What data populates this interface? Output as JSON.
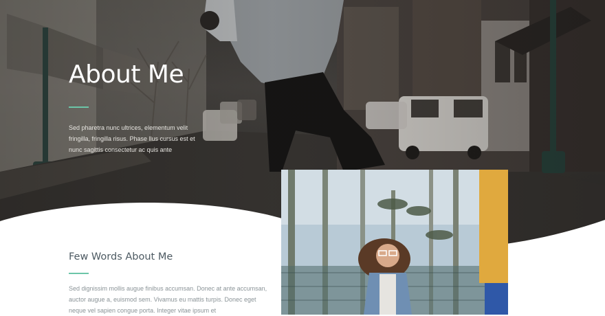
{
  "hero": {
    "title": "About Me",
    "text": "Sed pharetra nunc ultrices, elementum velit fringilla, fringilla risus. Phase llus cursus est et nunc sagittis consectetur ac quis ante"
  },
  "about": {
    "title": "Few Words About Me",
    "text": "Sed dignissim mollis augue finibus accumsan. Donec at ante accumsan, auctor augue a, euismod sem. Vivamus eu mattis turpis. Donec eget neque vel sapien congue porta. Integer vitae ipsum et"
  },
  "colors": {
    "accent": "#6cc6a8",
    "heading": "#4d5a62",
    "body_text": "#8a9397"
  }
}
